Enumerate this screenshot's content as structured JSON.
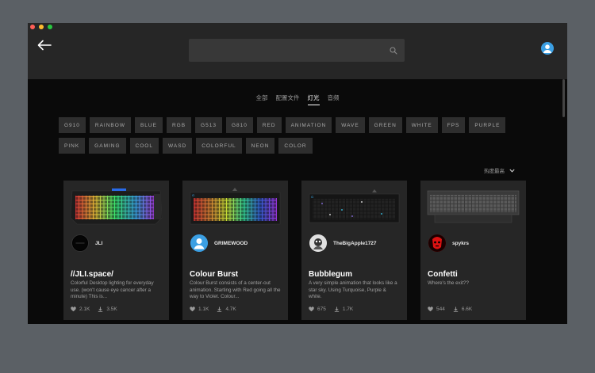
{
  "search": {
    "placeholder": ""
  },
  "tabs": [
    {
      "label": "全部"
    },
    {
      "label": "配置文件"
    },
    {
      "label": "灯光"
    },
    {
      "label": "音频"
    }
  ],
  "tags_row1": [
    "G910",
    "RAINBOW",
    "BLUE",
    "RGB",
    "G513",
    "G810",
    "RED",
    "ANIMATION",
    "WAVE",
    "GREEN",
    "WHITE",
    "FPS",
    "PURPLE"
  ],
  "tags_row2": [
    "PINK",
    "GAMING",
    "COOL",
    "WASD",
    "COLORFUL",
    "NEON",
    "COLOR"
  ],
  "sort_label": "热度最高",
  "cards": [
    {
      "author": "JLI",
      "title": "//JLI.space/",
      "description": "Colorful Desktop lighting for everyday use. (won't cause eye cancer after a minute) This is...",
      "likes": "2.1K",
      "downloads": "3.5K"
    },
    {
      "author": "GRIMEWOOD",
      "title": "Colour Burst",
      "description": "Colour Burst consists of a center-out animation. Starting with Red going all the way to Violet. Colour...",
      "likes": "1.1K",
      "downloads": "4.7K"
    },
    {
      "author": "TheBigApple1727",
      "title": "Bubblegum",
      "description": "A very simple animation that looks like a star sky. Using Turquoise, Purple & white.",
      "likes": "675",
      "downloads": "1.7K"
    },
    {
      "author": "spykrs",
      "title": "Confetti",
      "description": "Where's the exit??",
      "likes": "544",
      "downloads": "6.6K"
    }
  ]
}
